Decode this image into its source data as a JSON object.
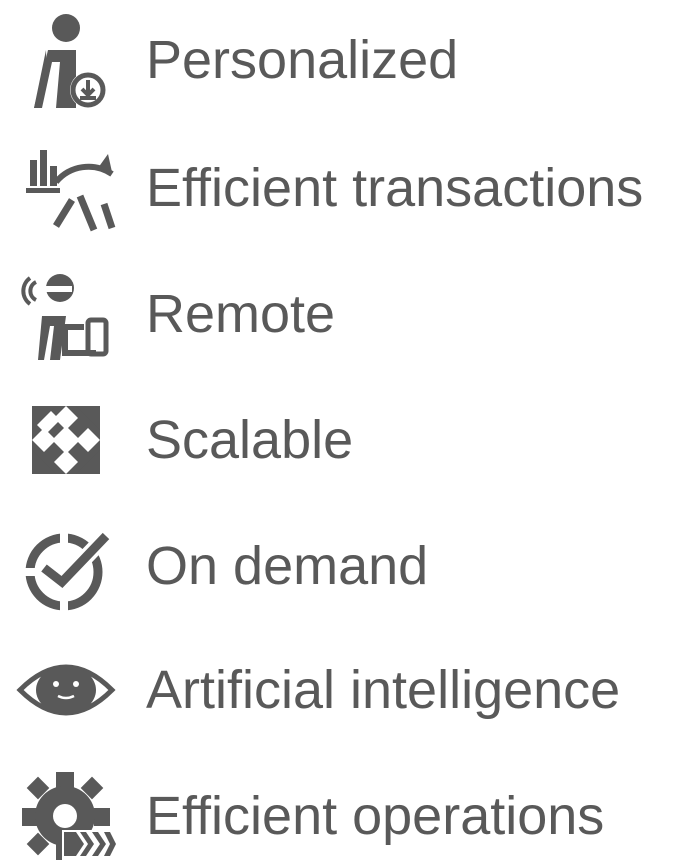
{
  "items": [
    {
      "label": "Personalized",
      "icon": "person-download-icon"
    },
    {
      "label": "Efficient transactions",
      "icon": "chart-gauge-icon"
    },
    {
      "label": "Remote",
      "icon": "remote-worker-icon"
    },
    {
      "label": "Scalable",
      "icon": "expand-arrows-icon"
    },
    {
      "label": "On demand",
      "icon": "clock-check-icon"
    },
    {
      "label": "Artificial intelligence",
      "icon": "eye-robot-icon"
    },
    {
      "label": "Efficient operations",
      "icon": "gear-arrows-icon"
    }
  ],
  "colors": {
    "text": "#595959",
    "icon": "#595959",
    "background": "#ffffff"
  }
}
